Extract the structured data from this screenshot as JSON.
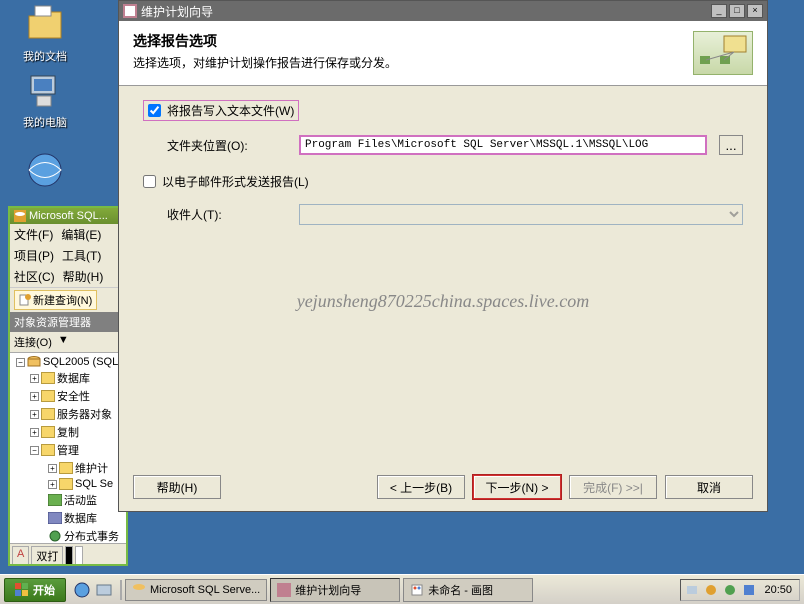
{
  "desktop": {
    "docs_label": "我的文档",
    "computer_label": "我的电脑",
    "net_label": ""
  },
  "ssms": {
    "title": "Microsoft SQL...",
    "menu": {
      "file": "文件(F)",
      "edit": "编辑(E)",
      "proj": "项目(P)",
      "tool": "工具(T)",
      "comm": "社区(C)",
      "help": "帮助(H)"
    },
    "new_query": "新建查询(N)",
    "explorer_title": "对象资源管理器",
    "connect": "连接(O)",
    "tree": {
      "root": "SQL2005 (SQL",
      "db": "数据库",
      "sec": "安全性",
      "sobj": "服务器对象",
      "repl": "复制",
      "mgmt": "管理",
      "maint": "维护计",
      "sqlse": "SQL Se",
      "actmon": "活动监",
      "datamg": "数据库",
      "dist": "分布式事务"
    },
    "strip_a": "A",
    "strip_b": "双打"
  },
  "wizard": {
    "title": "维护计划向导",
    "heading": "选择报告选项",
    "subheading": "选择选项，对维护计划操作报告进行保存或分发。",
    "write_text_file": "将报告写入文本文件(W)",
    "folder_label": "文件夹位置(O):",
    "folder_value": "Program Files\\Microsoft SQL Server\\MSSQL.1\\MSSQL\\LOG",
    "browse": "...",
    "email_report": "以电子邮件形式发送报告(L)",
    "recipient": "收件人(T):",
    "btn_help": "帮助(H)",
    "btn_back": "< 上一步(B)",
    "btn_next": "下一步(N) >",
    "btn_finish": "完成(F) >>|",
    "btn_cancel": "取消"
  },
  "watermark": "yejunsheng870225china.spaces.live.com",
  "taskbar": {
    "start": "开始",
    "task1": "Microsoft SQL Serve...",
    "task2": "维护计划向导",
    "task3": "未命名 - 画图",
    "clock": "20:50"
  }
}
